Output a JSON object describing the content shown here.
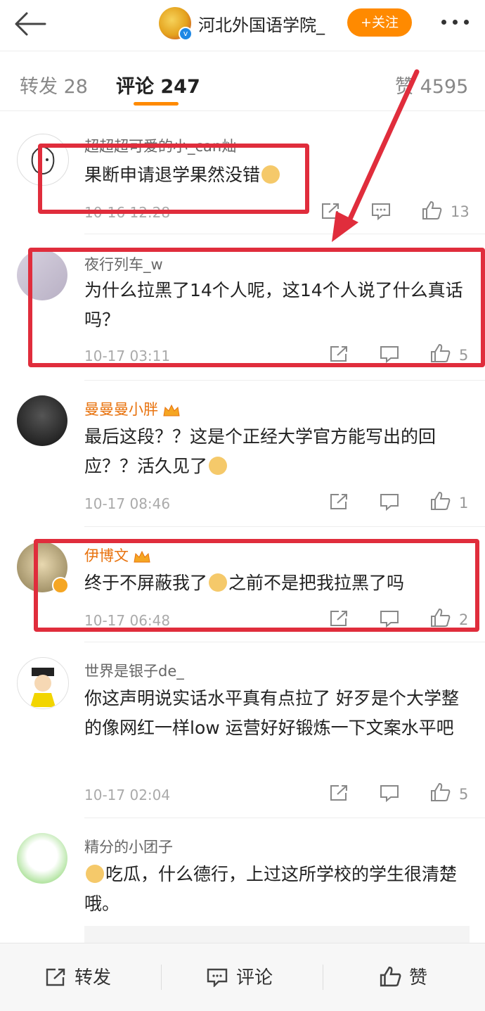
{
  "header": {
    "account_name": "河北外国语学院_",
    "follow_label": "+关注",
    "verified_mark": "v"
  },
  "tabs": [
    {
      "label": "转发 28"
    },
    {
      "label": "评论 247"
    },
    {
      "label": "赞 4595"
    }
  ],
  "comments": [
    {
      "user": "超超超可爱的小_can灿",
      "text": "果断申请退学果然没错",
      "emoji_after": "doge",
      "time": "10-16 12:28",
      "likes": "13"
    },
    {
      "user": "夜行列车_w",
      "text": "为什么拉黑了14个人呢，这14个人说了什么真话吗？",
      "time": "10-17 03:11",
      "likes": "5"
    },
    {
      "user": "曼曼曼小胖",
      "text": "最后这段？？这是个正经大学官方能写出的回应？？活久见了",
      "emoji_after": "laugh-cry",
      "time": "10-17 08:46",
      "likes": "1"
    },
    {
      "user": "伊博文",
      "text_before": "终于不屏蔽我了",
      "text_after": "之前不是把我拉黑了吗",
      "emoji_mid": "doge",
      "time": "10-17 06:48",
      "likes": "2"
    },
    {
      "user": "世界是银子de_",
      "text": "你这声明说实话水平真有点拉了  好歹是个大学整的像网红一样low  运营好好锻炼一下文案水平吧",
      "time": "10-17 02:04",
      "likes": "5"
    },
    {
      "user": "精分的小团子",
      "text": "吃瓜，什么德行，上过这所学校的学生很清楚哦。",
      "emoji_before": "doge"
    }
  ],
  "bottom_bar": {
    "repost": "转发",
    "comment": "评论",
    "like": "赞"
  },
  "colors": {
    "accent": "#ff8a00",
    "annotation_red": "#e02d3c",
    "vip_name": "#e8730f"
  }
}
